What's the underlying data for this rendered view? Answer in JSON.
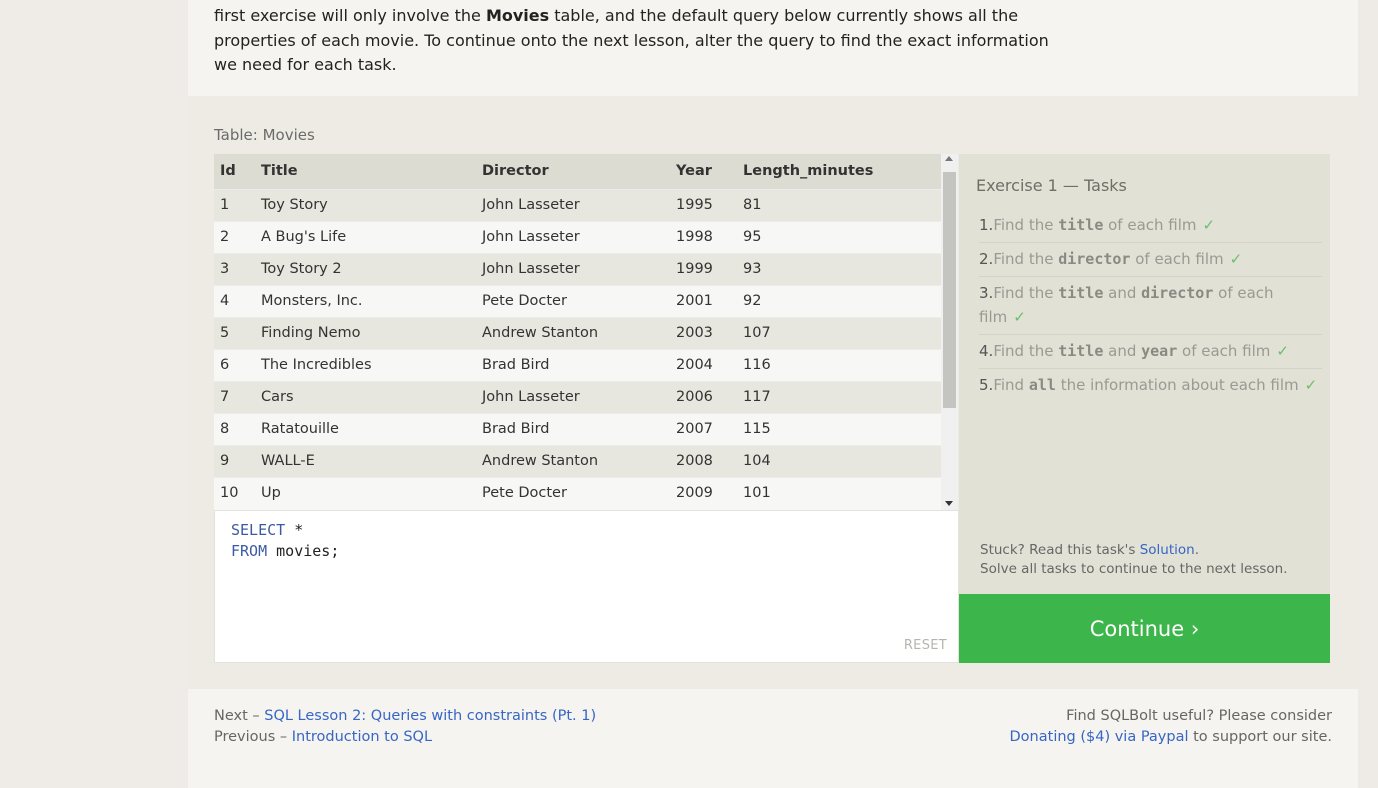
{
  "intro": {
    "part1": "first exercise will only involve the ",
    "bold": "Movies",
    "part2": " table, and the default query below currently shows all the properties of each movie. To continue onto the next lesson, alter the query to find the exact information we need for each task."
  },
  "table": {
    "caption": "Table: Movies",
    "headers": [
      "Id",
      "Title",
      "Director",
      "Year",
      "Length_minutes"
    ],
    "rows": [
      [
        "1",
        "Toy Story",
        "John Lasseter",
        "1995",
        "81"
      ],
      [
        "2",
        "A Bug's Life",
        "John Lasseter",
        "1998",
        "95"
      ],
      [
        "3",
        "Toy Story 2",
        "John Lasseter",
        "1999",
        "93"
      ],
      [
        "4",
        "Monsters, Inc.",
        "Pete Docter",
        "2001",
        "92"
      ],
      [
        "5",
        "Finding Nemo",
        "Andrew Stanton",
        "2003",
        "107"
      ],
      [
        "6",
        "The Incredibles",
        "Brad Bird",
        "2004",
        "116"
      ],
      [
        "7",
        "Cars",
        "John Lasseter",
        "2006",
        "117"
      ],
      [
        "8",
        "Ratatouille",
        "Brad Bird",
        "2007",
        "115"
      ],
      [
        "9",
        "WALL-E",
        "Andrew Stanton",
        "2008",
        "104"
      ],
      [
        "10",
        "Up",
        "Pete Docter",
        "2009",
        "101"
      ]
    ]
  },
  "editor": {
    "line1_kw": "SELECT",
    "line1_rest": " *",
    "line2_kw": "FROM",
    "line2_rest": " movies;",
    "reset_label": "RESET"
  },
  "tasks": {
    "title": "Exercise 1 — Tasks",
    "items": [
      {
        "num": "1.",
        "pre": "Find the ",
        "code": "title",
        "post": " of each film",
        "check": "✓"
      },
      {
        "num": "2.",
        "pre": "Find the ",
        "code": "director",
        "post": " of each film",
        "check": "✓"
      },
      {
        "num": "3.",
        "pre": "Find the ",
        "code": "title",
        "mid": " and ",
        "code2": "director",
        "post": " of each film",
        "check": "✓"
      },
      {
        "num": "4.",
        "pre": "Find the ",
        "code": "title",
        "mid": " and ",
        "code2": "year",
        "post": " of each film",
        "check": "✓"
      },
      {
        "num": "5.",
        "pre": "Find ",
        "code": "all",
        "post": " the information about each film",
        "check": "✓"
      }
    ],
    "stuck_pre": "Stuck? Read this task's ",
    "stuck_link": "Solution",
    "stuck_post": ".",
    "stuck_line2": "Solve all tasks to continue to the next lesson.",
    "continue_label": "Continue ›"
  },
  "footer": {
    "next_pre": "Next – ",
    "next_link": "SQL Lesson 2: Queries with constraints (Pt. 1)",
    "prev_pre": "Previous – ",
    "prev_link": "Introduction to SQL",
    "support_line1": "Find SQLBolt useful? Please consider",
    "donate_link": "Donating ($4) via Paypal",
    "support_post": " to support our site."
  },
  "colors": {
    "continue": "#3cb54a",
    "link": "#3766c4",
    "check": "#6cbf6c"
  }
}
